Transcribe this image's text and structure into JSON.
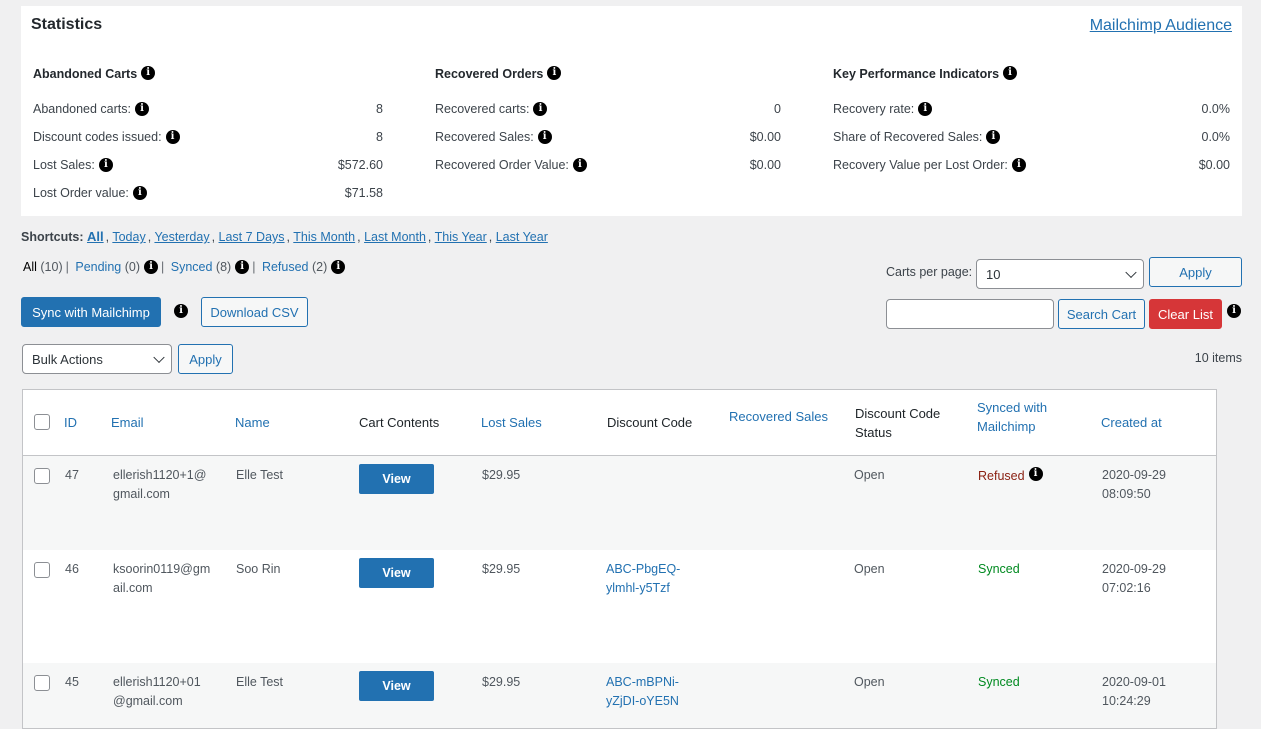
{
  "stats": {
    "title": "Statistics",
    "audience_link": "Mailchimp Audience",
    "abandoned": {
      "heading": "Abandoned Carts",
      "rows": [
        {
          "label": "Abandoned carts:",
          "value": "8"
        },
        {
          "label": "Discount codes issued:",
          "value": "8"
        },
        {
          "label": "Lost Sales:",
          "value": "$572.60"
        },
        {
          "label": "Lost Order value:",
          "value": "$71.58"
        }
      ]
    },
    "recovered": {
      "heading": "Recovered Orders",
      "rows": [
        {
          "label": "Recovered carts:",
          "value": "0"
        },
        {
          "label": "Recovered Sales:",
          "value": "$0.00"
        },
        {
          "label": "Recovered Order Value:",
          "value": "$0.00"
        }
      ]
    },
    "kpi": {
      "heading": "Key Performance Indicators",
      "rows": [
        {
          "label": "Recovery rate:",
          "value": "0.0%"
        },
        {
          "label": "Share of Recovered Sales:",
          "value": "0.0%"
        },
        {
          "label": "Recovery Value per Lost Order:",
          "value": "$0.00"
        }
      ]
    }
  },
  "shortcuts": {
    "label": "Shortcuts:",
    "links": [
      "All",
      "Today",
      "Yesterday",
      "Last 7 Days",
      "This Month",
      "Last Month",
      "This Year",
      "Last Year"
    ]
  },
  "filters": {
    "all": "All",
    "all_count": "(10)",
    "pending": "Pending",
    "pending_count": "(0)",
    "synced": "Synced",
    "synced_count": "(8)",
    "refused": "Refused",
    "refused_count": "(2)"
  },
  "toolbar": {
    "sync_label": "Sync with Mailchimp",
    "download_label": "Download CSV",
    "per_page_label": "Carts per page:",
    "per_page_value": "10",
    "apply_label": "Apply",
    "search_placeholder": "",
    "search_label": "Search Cart",
    "clear_label": "Clear List",
    "bulk_actions": "Bulk Actions",
    "bulk_apply": "Apply",
    "items_count": "10 items"
  },
  "table": {
    "headers": {
      "id": "ID",
      "email": "Email",
      "name": "Name",
      "cart": "Cart Contents",
      "lost": "Lost Sales",
      "code": "Discount Code",
      "recovered": "Recovered Sales",
      "status_1": "Discount Code",
      "status_2": "Status",
      "synced_1": "Synced with",
      "synced_2": "Mailchimp",
      "created": "Created at"
    },
    "view_label": "View",
    "rows": [
      {
        "id": "47",
        "email_1": "ellerish1120+1@",
        "email_2": "gmail.com",
        "name": "Elle Test",
        "lost": "$29.95",
        "code_1": "",
        "code_2": "",
        "status": "Open",
        "sync": "Refused",
        "date": "2020-09-29",
        "time": "08:09:50"
      },
      {
        "id": "46",
        "email_1": "ksoorin0119@gm",
        "email_2": "ail.com",
        "name": "Soo Rin",
        "lost": "$29.95",
        "code_1": "ABC-PbgEQ-",
        "code_2": "ylmhl-y5Tzf",
        "status": "Open",
        "sync": "Synced",
        "date": "2020-09-29",
        "time": "07:02:16"
      },
      {
        "id": "45",
        "email_1": "ellerish1120+01",
        "email_2": "@gmail.com",
        "name": "Elle Test",
        "lost": "$29.95",
        "code_1": "ABC-mBPNi-",
        "code_2": "yZjDI-oYE5N",
        "status": "Open",
        "sync": "Synced",
        "date": "2020-09-01",
        "time": "10:24:29"
      }
    ]
  }
}
